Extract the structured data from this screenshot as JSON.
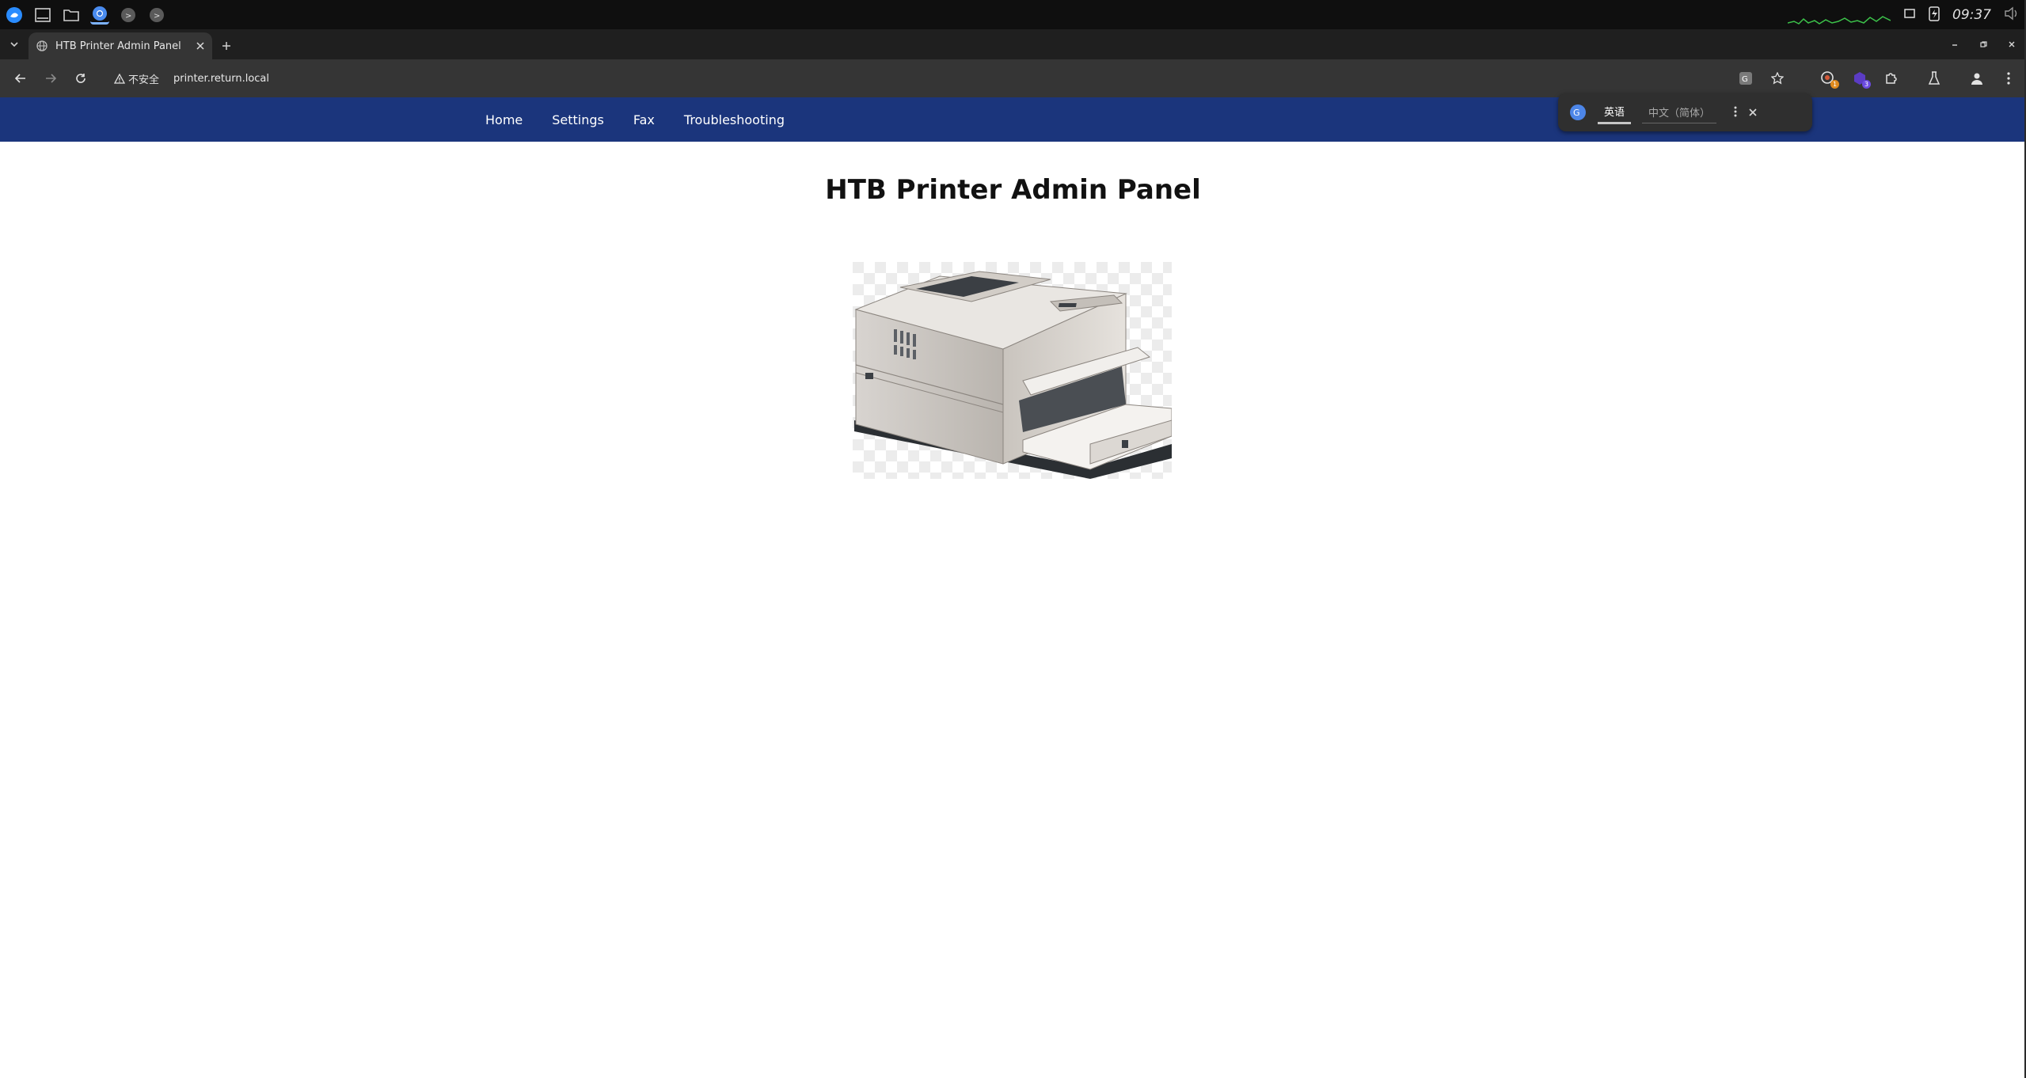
{
  "taskbar": {
    "clock": "09:37",
    "apps": [
      "app-menu-icon",
      "terminal-icon",
      "folder-icon",
      "chrome-icon",
      "app-icon-1",
      "app-icon-2"
    ]
  },
  "browser": {
    "tab": {
      "title": "HTB Printer Admin Panel"
    },
    "address": {
      "security_label": "不安全",
      "url": "printer.return.local"
    },
    "extension_badges": {
      "first": "1",
      "second": "3"
    }
  },
  "translate_popup": {
    "source_lang": "英语",
    "target_lang": "中文（简体）"
  },
  "page": {
    "nav": {
      "items": [
        {
          "label": "Home"
        },
        {
          "label": "Settings"
        },
        {
          "label": "Fax"
        },
        {
          "label": "Troubleshooting"
        }
      ]
    },
    "title": "HTB Printer Admin Panel"
  },
  "colors": {
    "nav_bg": "#1b357c",
    "browser_toolbar": "#353535",
    "tabstrip": "#1f1f1f"
  }
}
